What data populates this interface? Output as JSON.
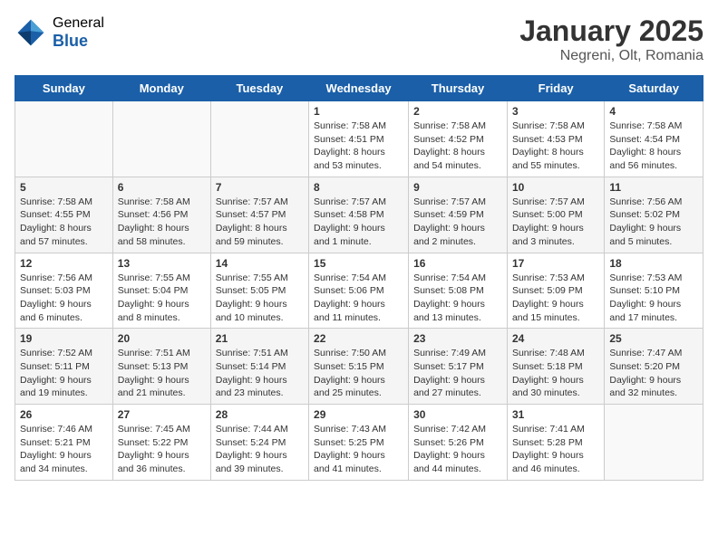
{
  "logo": {
    "general": "General",
    "blue": "Blue"
  },
  "title": "January 2025",
  "location": "Negreni, Olt, Romania",
  "days_of_week": [
    "Sunday",
    "Monday",
    "Tuesday",
    "Wednesday",
    "Thursday",
    "Friday",
    "Saturday"
  ],
  "weeks": [
    [
      {
        "day": "",
        "info": ""
      },
      {
        "day": "",
        "info": ""
      },
      {
        "day": "",
        "info": ""
      },
      {
        "day": "1",
        "info": "Sunrise: 7:58 AM\nSunset: 4:51 PM\nDaylight: 8 hours and 53 minutes."
      },
      {
        "day": "2",
        "info": "Sunrise: 7:58 AM\nSunset: 4:52 PM\nDaylight: 8 hours and 54 minutes."
      },
      {
        "day": "3",
        "info": "Sunrise: 7:58 AM\nSunset: 4:53 PM\nDaylight: 8 hours and 55 minutes."
      },
      {
        "day": "4",
        "info": "Sunrise: 7:58 AM\nSunset: 4:54 PM\nDaylight: 8 hours and 56 minutes."
      }
    ],
    [
      {
        "day": "5",
        "info": "Sunrise: 7:58 AM\nSunset: 4:55 PM\nDaylight: 8 hours and 57 minutes."
      },
      {
        "day": "6",
        "info": "Sunrise: 7:58 AM\nSunset: 4:56 PM\nDaylight: 8 hours and 58 minutes."
      },
      {
        "day": "7",
        "info": "Sunrise: 7:57 AM\nSunset: 4:57 PM\nDaylight: 8 hours and 59 minutes."
      },
      {
        "day": "8",
        "info": "Sunrise: 7:57 AM\nSunset: 4:58 PM\nDaylight: 9 hours and 1 minute."
      },
      {
        "day": "9",
        "info": "Sunrise: 7:57 AM\nSunset: 4:59 PM\nDaylight: 9 hours and 2 minutes."
      },
      {
        "day": "10",
        "info": "Sunrise: 7:57 AM\nSunset: 5:00 PM\nDaylight: 9 hours and 3 minutes."
      },
      {
        "day": "11",
        "info": "Sunrise: 7:56 AM\nSunset: 5:02 PM\nDaylight: 9 hours and 5 minutes."
      }
    ],
    [
      {
        "day": "12",
        "info": "Sunrise: 7:56 AM\nSunset: 5:03 PM\nDaylight: 9 hours and 6 minutes."
      },
      {
        "day": "13",
        "info": "Sunrise: 7:55 AM\nSunset: 5:04 PM\nDaylight: 9 hours and 8 minutes."
      },
      {
        "day": "14",
        "info": "Sunrise: 7:55 AM\nSunset: 5:05 PM\nDaylight: 9 hours and 10 minutes."
      },
      {
        "day": "15",
        "info": "Sunrise: 7:54 AM\nSunset: 5:06 PM\nDaylight: 9 hours and 11 minutes."
      },
      {
        "day": "16",
        "info": "Sunrise: 7:54 AM\nSunset: 5:08 PM\nDaylight: 9 hours and 13 minutes."
      },
      {
        "day": "17",
        "info": "Sunrise: 7:53 AM\nSunset: 5:09 PM\nDaylight: 9 hours and 15 minutes."
      },
      {
        "day": "18",
        "info": "Sunrise: 7:53 AM\nSunset: 5:10 PM\nDaylight: 9 hours and 17 minutes."
      }
    ],
    [
      {
        "day": "19",
        "info": "Sunrise: 7:52 AM\nSunset: 5:11 PM\nDaylight: 9 hours and 19 minutes."
      },
      {
        "day": "20",
        "info": "Sunrise: 7:51 AM\nSunset: 5:13 PM\nDaylight: 9 hours and 21 minutes."
      },
      {
        "day": "21",
        "info": "Sunrise: 7:51 AM\nSunset: 5:14 PM\nDaylight: 9 hours and 23 minutes."
      },
      {
        "day": "22",
        "info": "Sunrise: 7:50 AM\nSunset: 5:15 PM\nDaylight: 9 hours and 25 minutes."
      },
      {
        "day": "23",
        "info": "Sunrise: 7:49 AM\nSunset: 5:17 PM\nDaylight: 9 hours and 27 minutes."
      },
      {
        "day": "24",
        "info": "Sunrise: 7:48 AM\nSunset: 5:18 PM\nDaylight: 9 hours and 30 minutes."
      },
      {
        "day": "25",
        "info": "Sunrise: 7:47 AM\nSunset: 5:20 PM\nDaylight: 9 hours and 32 minutes."
      }
    ],
    [
      {
        "day": "26",
        "info": "Sunrise: 7:46 AM\nSunset: 5:21 PM\nDaylight: 9 hours and 34 minutes."
      },
      {
        "day": "27",
        "info": "Sunrise: 7:45 AM\nSunset: 5:22 PM\nDaylight: 9 hours and 36 minutes."
      },
      {
        "day": "28",
        "info": "Sunrise: 7:44 AM\nSunset: 5:24 PM\nDaylight: 9 hours and 39 minutes."
      },
      {
        "day": "29",
        "info": "Sunrise: 7:43 AM\nSunset: 5:25 PM\nDaylight: 9 hours and 41 minutes."
      },
      {
        "day": "30",
        "info": "Sunrise: 7:42 AM\nSunset: 5:26 PM\nDaylight: 9 hours and 44 minutes."
      },
      {
        "day": "31",
        "info": "Sunrise: 7:41 AM\nSunset: 5:28 PM\nDaylight: 9 hours and 46 minutes."
      },
      {
        "day": "",
        "info": ""
      }
    ]
  ]
}
